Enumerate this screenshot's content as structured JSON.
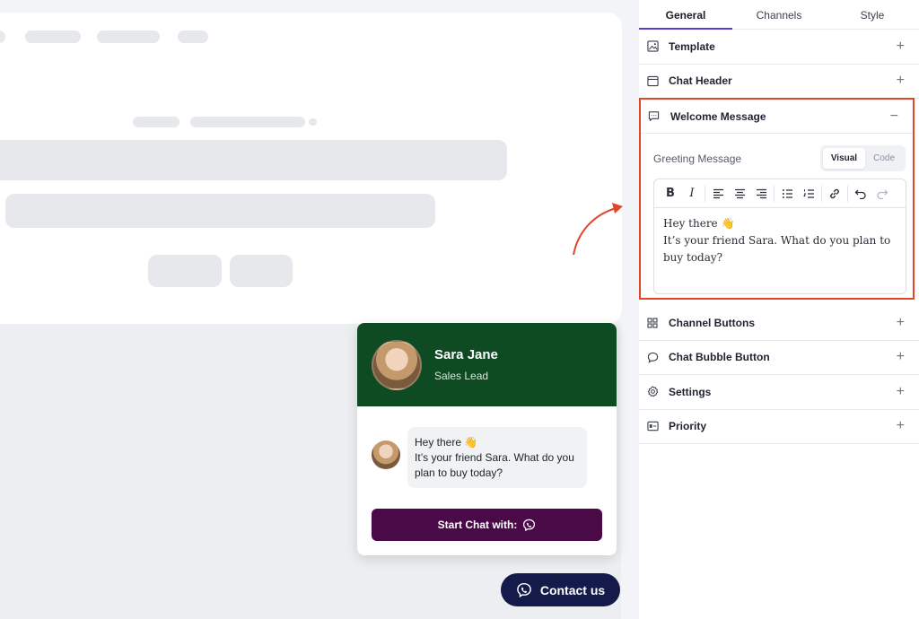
{
  "preview": {
    "agent_name": "Sara Jane",
    "agent_role": "Sales Lead",
    "message_line1": "Hey there 👋",
    "message_line2": "It’s your friend Sara. What do you plan to buy today?",
    "start_chat_label": "Start Chat with:",
    "contact_label": "Contact us",
    "colors": {
      "header": "#0e4a22",
      "start_button": "#4a0a47",
      "contact_button": "#141a4a"
    }
  },
  "panel": {
    "tabs": [
      {
        "label": "General",
        "active": true
      },
      {
        "label": "Channels",
        "active": false
      },
      {
        "label": "Style",
        "active": false
      }
    ],
    "sections_top": [
      {
        "label": "Template",
        "icon": "image-icon",
        "toggle": "+"
      },
      {
        "label": "Chat Header",
        "icon": "window-icon",
        "toggle": "+"
      }
    ],
    "welcome": {
      "label": "Welcome Message",
      "toggle": "−",
      "greeting_label": "Greeting Message",
      "mode_visual": "Visual",
      "mode_code": "Code",
      "editor_line1": "Hey there 👋",
      "editor_line2": "It’s your friend Sara. What do you plan to buy today?"
    },
    "sections_bottom": [
      {
        "label": "Channel Buttons",
        "icon": "grid-icon",
        "toggle": "+"
      },
      {
        "label": "Chat Bubble Button",
        "icon": "chat-bubble-icon",
        "toggle": "+"
      },
      {
        "label": "Settings",
        "icon": "gear-icon",
        "toggle": "+"
      },
      {
        "label": "Priority",
        "icon": "priority-icon",
        "toggle": "+"
      }
    ],
    "highlight_color": "#e0462a",
    "accent_color": "#5b3fd9"
  }
}
